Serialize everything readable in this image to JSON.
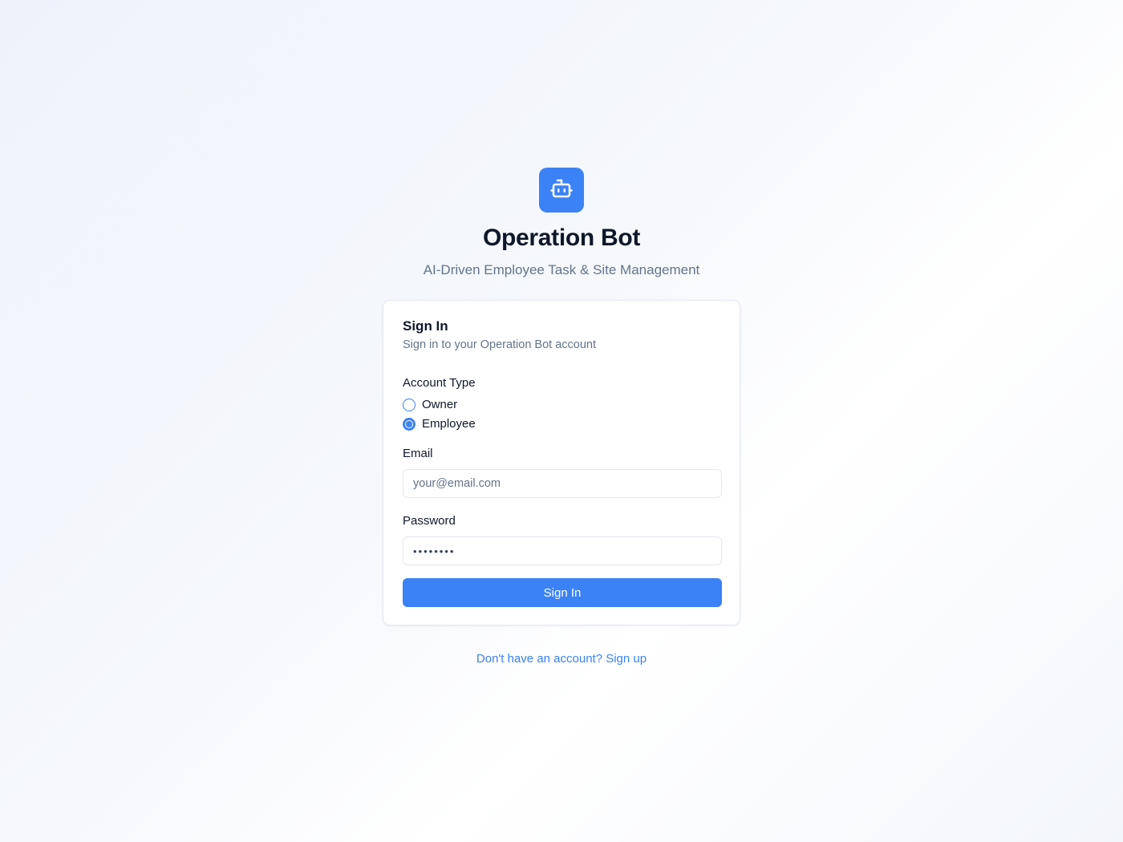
{
  "brand": {
    "logo_icon": "bot-icon",
    "accent_color": "#3b82f6",
    "title": "Operation Bot",
    "subtitle": "AI-Driven Employee Task & Site Management"
  },
  "card": {
    "title": "Sign In",
    "description": "Sign in to your Operation Bot account"
  },
  "account_type": {
    "label": "Account Type",
    "options": [
      {
        "label": "Owner",
        "checked": false
      },
      {
        "label": "Employee",
        "checked": true
      }
    ]
  },
  "email": {
    "label": "Email",
    "placeholder": "your@email.com",
    "value": ""
  },
  "password": {
    "label": "Password",
    "value": "••••••••"
  },
  "submit_label": "Sign In",
  "signup_link": "Don't have an account? Sign up"
}
